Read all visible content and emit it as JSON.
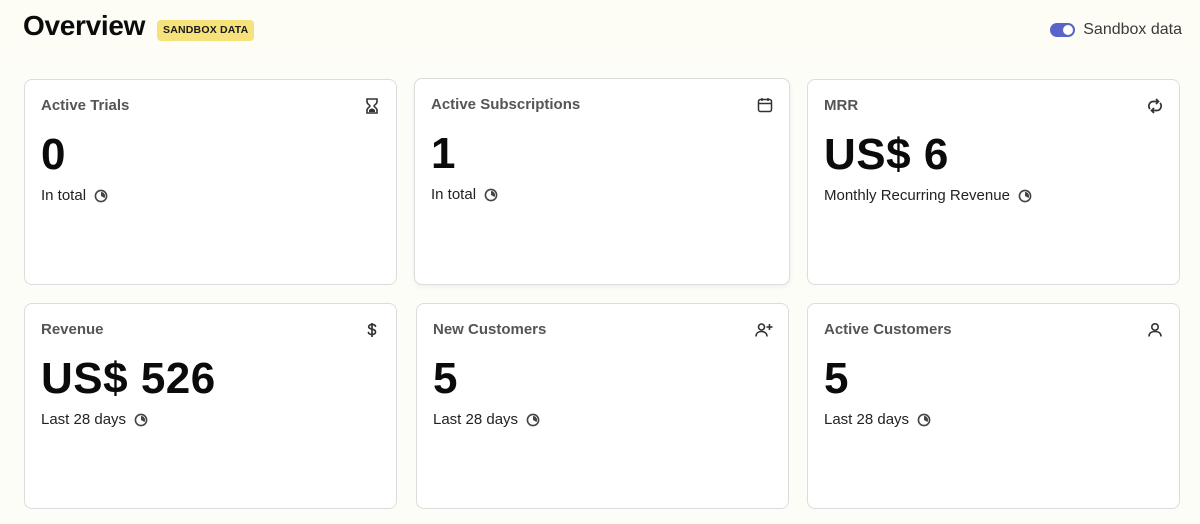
{
  "header": {
    "title": "Overview",
    "badge": "SANDBOX DATA",
    "toggle_label": "Sandbox data",
    "toggle_on": true
  },
  "colors": {
    "badge_bg": "#f6e27a",
    "toggle_on": "#5a63c9"
  },
  "cards": [
    {
      "title": "Active Trials",
      "value": "0",
      "subtitle": "In total",
      "icon": "hourglass-icon"
    },
    {
      "title": "Active Subscriptions",
      "value": "1",
      "subtitle": "In total",
      "icon": "calendar-icon"
    },
    {
      "title": "MRR",
      "value": "US$ 6",
      "subtitle": "Monthly Recurring Revenue",
      "icon": "refresh-icon"
    },
    {
      "title": "Revenue",
      "value": "US$ 526",
      "subtitle": "Last 28 days",
      "icon": "dollar-icon"
    },
    {
      "title": "New Customers",
      "value": "5",
      "subtitle": "Last 28 days",
      "icon": "add-user-icon"
    },
    {
      "title": "Active Customers",
      "value": "5",
      "subtitle": "Last 28 days",
      "icon": "user-icon"
    }
  ]
}
